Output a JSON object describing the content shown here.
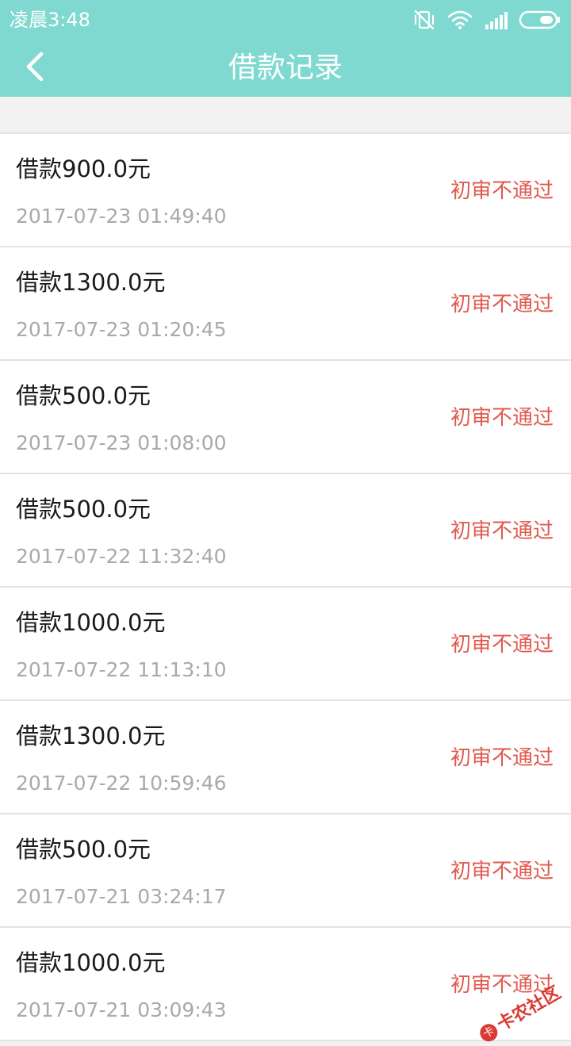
{
  "status_bar": {
    "time": "凌晨3:48",
    "icons": [
      "vibrate-off-icon",
      "wifi-icon",
      "signal-icon",
      "battery-icon"
    ]
  },
  "header": {
    "title": "借款记录",
    "back_icon": "back-arrow-icon",
    "background_color": "#7fd9d0"
  },
  "records": [
    {
      "amount": "借款900.0元",
      "time": "2017-07-23 01:49:40",
      "status": "初审不通过"
    },
    {
      "amount": "借款1300.0元",
      "time": "2017-07-23 01:20:45",
      "status": "初审不通过"
    },
    {
      "amount": "借款500.0元",
      "time": "2017-07-23 01:08:00",
      "status": "初审不通过"
    },
    {
      "amount": "借款500.0元",
      "time": "2017-07-22 11:32:40",
      "status": "初审不通过"
    },
    {
      "amount": "借款1000.0元",
      "time": "2017-07-22 11:13:10",
      "status": "初审不通过"
    },
    {
      "amount": "借款1300.0元",
      "time": "2017-07-22 10:59:46",
      "status": "初审不通过"
    },
    {
      "amount": "借款500.0元",
      "time": "2017-07-21 03:24:17",
      "status": "初审不通过"
    },
    {
      "amount": "借款1000.0元",
      "time": "2017-07-21 03:09:43",
      "status": "初审不通过"
    }
  ],
  "colors": {
    "status_rejected": "#e05a4f",
    "timestamp": "#a9a9a9"
  },
  "watermark": {
    "text": "卡农社区"
  }
}
